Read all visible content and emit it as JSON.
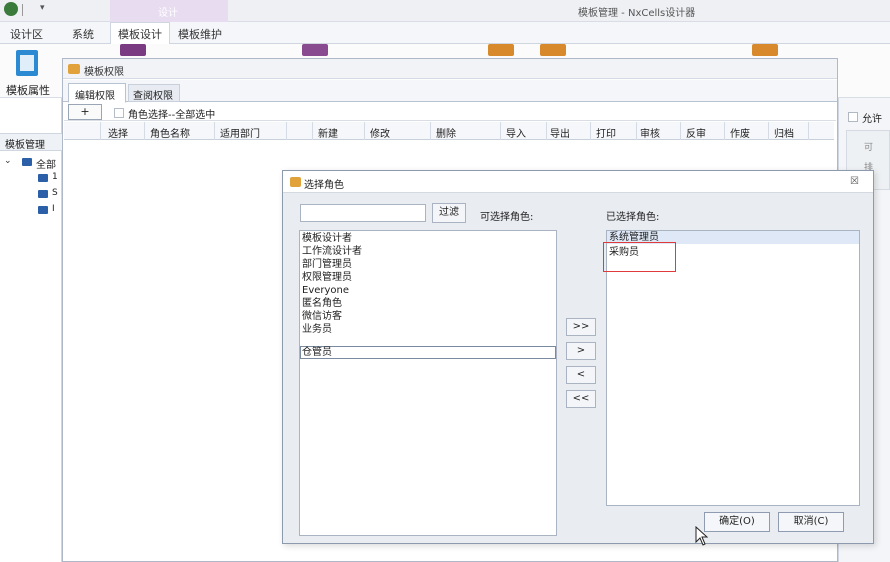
{
  "titlebar": {
    "quick_icon": "green-app-icon",
    "qa_arrow": "▾",
    "context_label": "设计",
    "app_title": "模板管理 - NxCells设计器"
  },
  "ribbon": {
    "tabs": [
      "设计区",
      "系统",
      "模板设计",
      "模板维护"
    ],
    "active_tab": "模板设计",
    "template_property_label": "模板属性"
  },
  "left_nav": {
    "header": "模板管理",
    "tree_root": "全部",
    "children": [
      "1",
      "S",
      "I"
    ]
  },
  "perm_window": {
    "title": "模板权限",
    "tabs": [
      "编辑权限",
      "查阅权限"
    ],
    "add_button": "+",
    "select_all_label": "角色选择--全部选中",
    "columns": [
      "选择",
      "角色名称",
      "适用部门",
      "新建",
      "修改",
      "删除",
      "导入",
      "导出",
      "打印",
      "审核",
      "反审",
      "作废",
      "归档"
    ]
  },
  "right_panel": {
    "allow_label": "允许",
    "partial_items": [
      "可",
      "排"
    ]
  },
  "dialog": {
    "title": "选择角色",
    "close_glyph": "☒",
    "filter_value": "",
    "filter_button": "过滤",
    "available_label": "可选择角色:",
    "selected_label": "已选择角色:",
    "available_roles": [
      "模板设计者",
      "工作流设计者",
      "部门管理员",
      "权限管理员",
      "Everyone",
      "匿名角色",
      "微信访客",
      "业务员",
      "仓管员"
    ],
    "highlighted_role": "仓管员",
    "selected_roles": [
      "系统管理员",
      "采购员"
    ],
    "move_buttons": [
      ">>",
      ">",
      "<",
      "<<"
    ],
    "ok_button": "确定(O)",
    "cancel_button": "取消(C)"
  }
}
